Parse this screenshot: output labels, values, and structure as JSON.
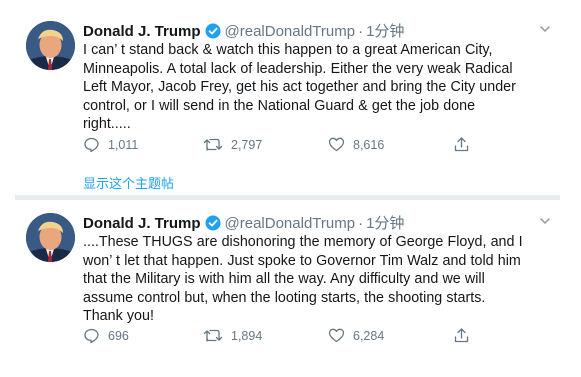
{
  "colors": {
    "accent": "#1da1f2",
    "muted": "#657786",
    "divider": "#e6ecf0"
  },
  "tweets": [
    {
      "name": "Donald J. Trump",
      "handle": "@realDonaldTrump",
      "separator": "·",
      "time": "1分钟",
      "text": "I can’ t stand back & watch this happen to a great American City,\nMinneapolis. A total lack of leadership. Either the very weak Radical\nLeft Mayor, Jacob Frey, get his act together and bring the City under\ncontrol, or I will send in the National Guard & get the job done\nright.....",
      "replies": "1,011",
      "retweets": "2,797",
      "likes": "8,616",
      "thread_link": "显示这个主题帖"
    },
    {
      "name": "Donald J. Trump",
      "handle": "@realDonaldTrump",
      "separator": "·",
      "time": "1分钟",
      "text": "....These THUGS are dishonoring the memory of George Floyd, and I\nwon’ t let that happen. Just spoke to Governor Tim Walz and told him\nthat the Military is with him all the way. Any difficulty and we will\nassume control but, when the looting starts, the shooting starts.\nThank you!",
      "replies": "696",
      "retweets": "1,894",
      "likes": "6,284"
    }
  ],
  "icons": {
    "verified": "verified-badge-icon",
    "caret": "chevron-down-icon",
    "reply": "reply-icon",
    "retweet": "retweet-icon",
    "like": "heart-icon",
    "share": "share-icon"
  }
}
